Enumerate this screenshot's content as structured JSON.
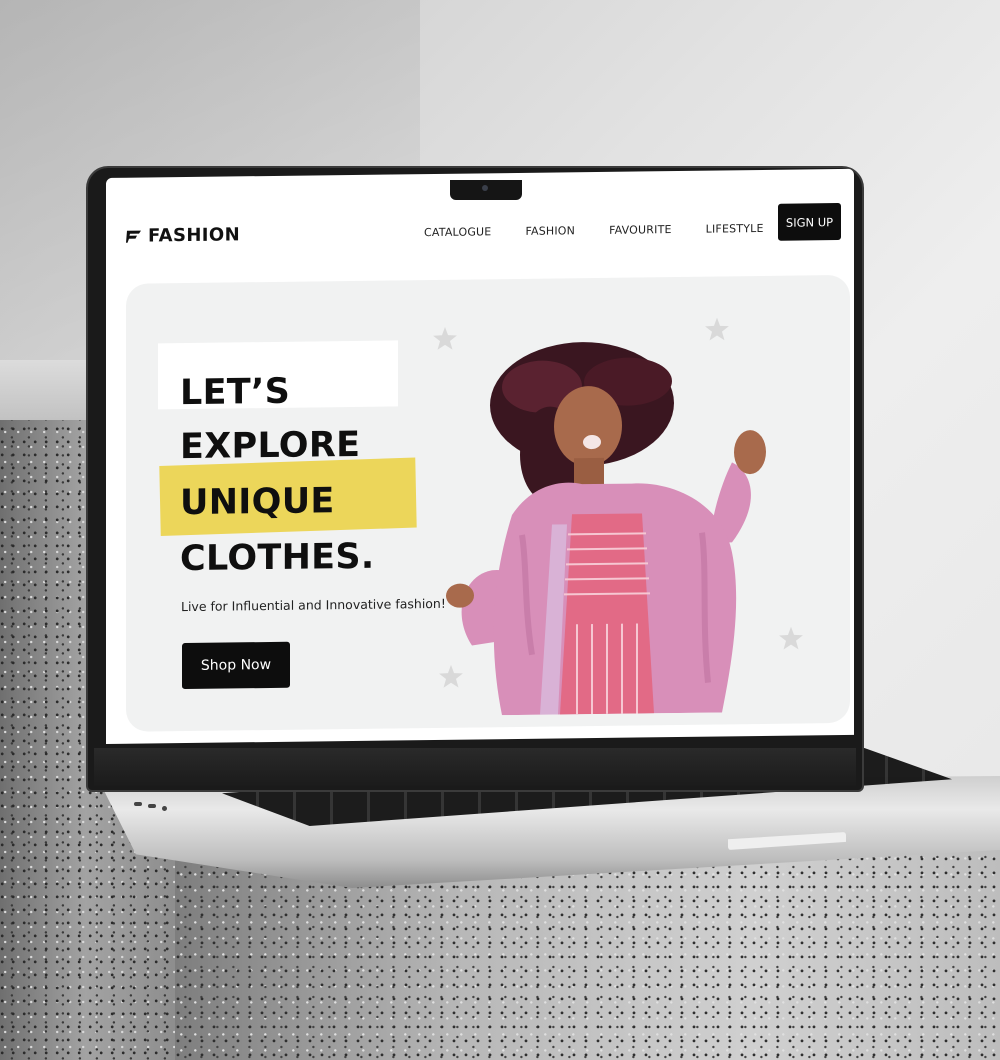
{
  "brand": {
    "name": "FASHION",
    "icon": "fashion-logo-icon"
  },
  "nav": {
    "links": [
      "CATALOGUE",
      "FASHION",
      "FAVOURITE",
      "LIFESTYLE"
    ],
    "signup_label": "SIGN UP"
  },
  "hero": {
    "headline": [
      "LET’S",
      "EXPLORE",
      "UNIQUE",
      "CLOTHES."
    ],
    "tagline": "Live for Influential and Innovative fashion!",
    "cta_label": "Shop Now",
    "decor_icon": "star-icon",
    "image": "model-photo"
  },
  "colors": {
    "accent_yellow": "#ecd65a",
    "hero_background": "#f1f2f2",
    "button_black": "#0d0d0d",
    "coat_pink": "#d88fb9",
    "star_grey": "#d9d9d9"
  }
}
